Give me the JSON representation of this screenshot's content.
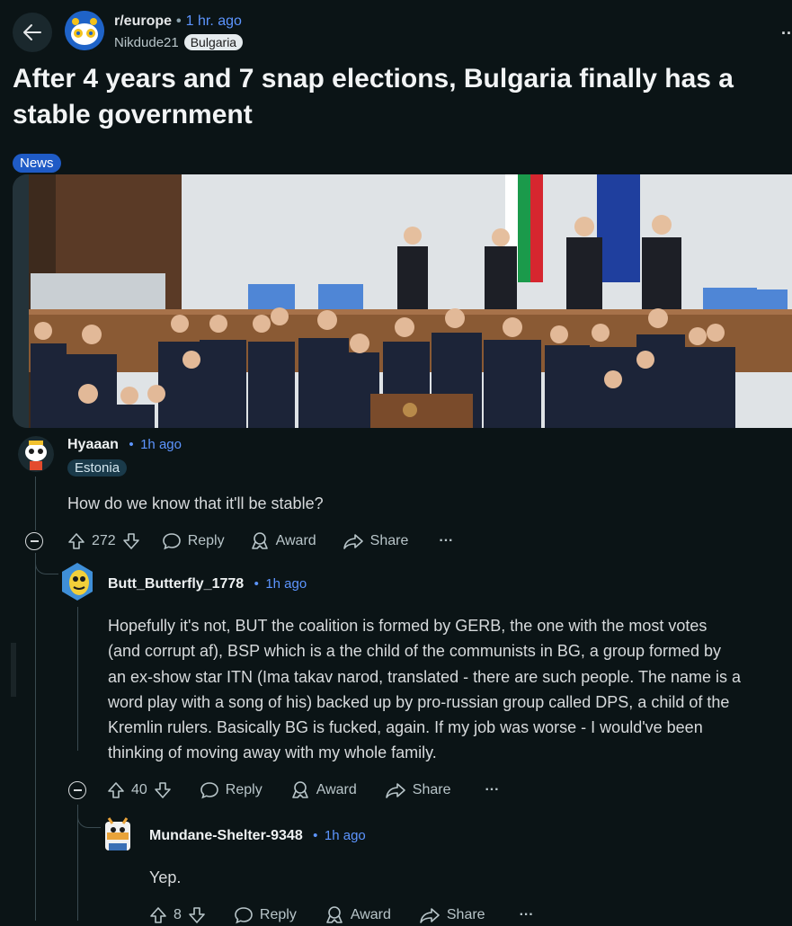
{
  "header": {
    "subreddit": "r/europe",
    "separator": "•",
    "time": "1 hr. ago",
    "author": "Nikdude21",
    "author_flair": "Bulgaria",
    "more": "..."
  },
  "post": {
    "title": "After 4 years and 7 snap elections, Bulgaria finally has a stable government",
    "flair": "News"
  },
  "comments": [
    {
      "user": "Hyaaan",
      "sep": "•",
      "time": "1h ago",
      "flair": "Estonia",
      "body": "How do we know that it'll be stable?",
      "score": "272",
      "reply": "Reply",
      "award": "Award",
      "share": "Share",
      "more": "···"
    },
    {
      "user": "Butt_Butterfly_1778",
      "sep": "•",
      "time": "1h ago",
      "body_lines": [
        "Hopefully it's not, BUT the coalition is formed by GERB, the one with the most votes",
        "(and corrupt af), BSP which is a the child of the communists in BG, a group formed by",
        "an ex-show star ITN (Ima takav narod, translated - there are such people. The name is a",
        "word play with a song of his) backed up by pro-russian group called DPS, a child of the",
        "Kremlin rulers. Basically BG is fucked, again. If my job was worse - I would've been",
        "thinking of moving away with my whole family."
      ],
      "score": "40",
      "reply": "Reply",
      "award": "Award",
      "share": "Share",
      "more": "···"
    },
    {
      "user": "Mundane-Shelter-9348",
      "sep": "•",
      "time": "1h ago",
      "body": "Yep.",
      "score": "8",
      "reply": "Reply",
      "award": "Award",
      "share": "Share",
      "more": "···"
    }
  ],
  "colors": {
    "background": "#0b1416",
    "link_blue": "#5d95ff",
    "news_flair": "#1f5bc6"
  }
}
